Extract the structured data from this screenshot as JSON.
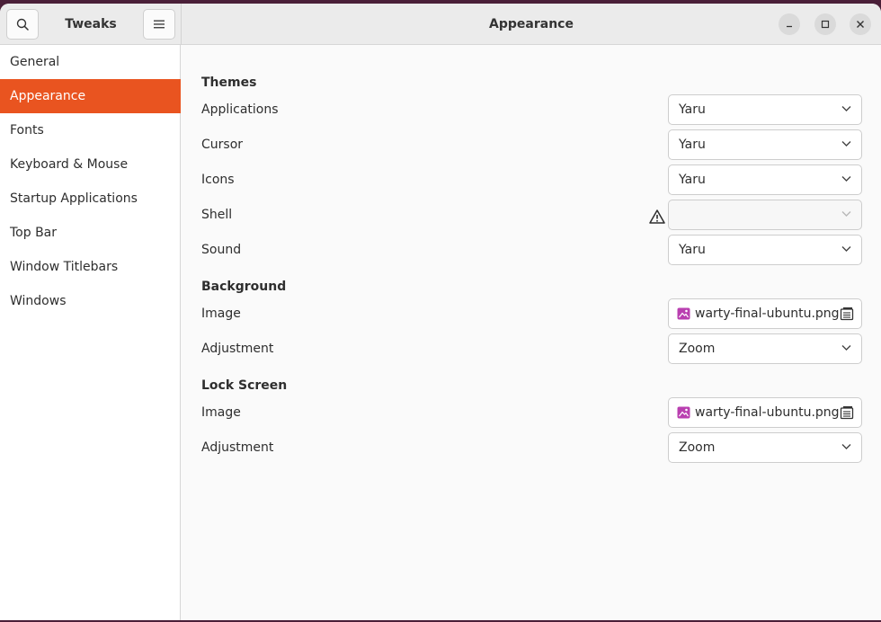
{
  "app": {
    "name": "Tweaks",
    "page_title": "Appearance"
  },
  "header": {
    "search_icon": "search-icon",
    "menu_icon": "hamburger-menu-icon",
    "window_controls": [
      "minimize",
      "maximize",
      "close"
    ]
  },
  "sidebar": {
    "items": [
      {
        "label": "General",
        "active": false
      },
      {
        "label": "Appearance",
        "active": true
      },
      {
        "label": "Fonts",
        "active": false
      },
      {
        "label": "Keyboard & Mouse",
        "active": false
      },
      {
        "label": "Startup Applications",
        "active": false
      },
      {
        "label": "Top Bar",
        "active": false
      },
      {
        "label": "Window Titlebars",
        "active": false
      },
      {
        "label": "Windows",
        "active": false
      }
    ]
  },
  "themes": {
    "title": "Themes",
    "applications": {
      "label": "Applications",
      "value": "Yaru"
    },
    "cursor": {
      "label": "Cursor",
      "value": "Yaru"
    },
    "icons": {
      "label": "Icons",
      "value": "Yaru"
    },
    "shell": {
      "label": "Shell",
      "value": "",
      "warning_icon": "warning-icon"
    },
    "sound": {
      "label": "Sound",
      "value": "Yaru"
    }
  },
  "background": {
    "title": "Background",
    "image": {
      "label": "Image",
      "file": "warty-final-ubuntu.png"
    },
    "adjustment": {
      "label": "Adjustment",
      "value": "Zoom"
    }
  },
  "lock_screen": {
    "title": "Lock Screen",
    "image": {
      "label": "Image",
      "file": "warty-final-ubuntu.png"
    },
    "adjustment": {
      "label": "Adjustment",
      "value": "Zoom"
    }
  },
  "colors": {
    "accent": "#e95420",
    "file_icon": "#b93fb0"
  }
}
